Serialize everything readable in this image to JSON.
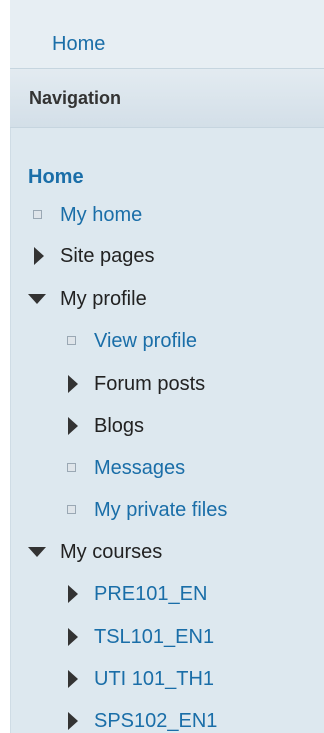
{
  "breadcrumb": {
    "home": "Home"
  },
  "block": {
    "title": "Navigation"
  },
  "nav": {
    "root": "Home",
    "items": [
      {
        "label": "My home",
        "icon": "bullet-icon",
        "type": "link"
      },
      {
        "label": "Site pages",
        "icon": "collapsed-arrow-icon",
        "type": "plain"
      },
      {
        "label": "My profile",
        "icon": "expanded-arrow-icon",
        "type": "plain"
      },
      {
        "label": "View profile",
        "icon": "bullet-icon",
        "type": "link"
      },
      {
        "label": "Forum posts",
        "icon": "collapsed-arrow-icon",
        "type": "plain"
      },
      {
        "label": "Blogs",
        "icon": "collapsed-arrow-icon",
        "type": "plain"
      },
      {
        "label": "Messages",
        "icon": "bullet-icon",
        "type": "link"
      },
      {
        "label": "My private files",
        "icon": "bullet-icon",
        "type": "link"
      },
      {
        "label": "My courses",
        "icon": "expanded-arrow-icon",
        "type": "plain"
      },
      {
        "label": "PRE101_EN",
        "icon": "collapsed-arrow-icon",
        "type": "link"
      },
      {
        "label": "TSL101_EN1",
        "icon": "collapsed-arrow-icon",
        "type": "link"
      },
      {
        "label": "UTI 101_TH1",
        "icon": "collapsed-arrow-icon",
        "type": "link"
      },
      {
        "label": "SPS102_EN1",
        "icon": "collapsed-arrow-icon",
        "type": "link"
      }
    ]
  },
  "colors": {
    "link": "#1a6ea8",
    "panel": "#dde8ef",
    "text": "#222222"
  }
}
